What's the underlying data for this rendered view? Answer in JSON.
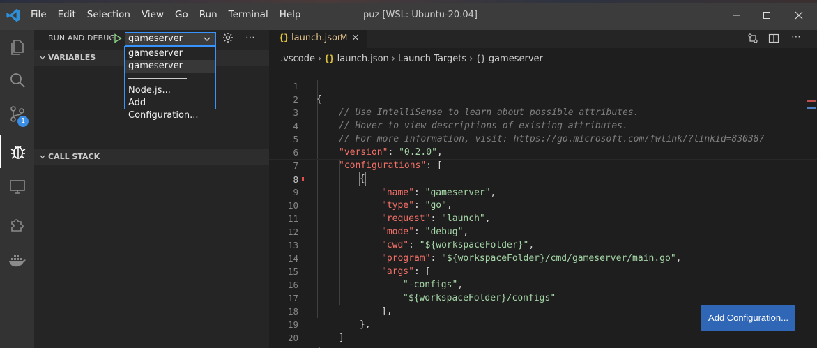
{
  "titlebar": {
    "menu": [
      "File",
      "Edit",
      "Selection",
      "View",
      "Go",
      "Run",
      "Terminal",
      "Help"
    ],
    "window_title": "puz [WSL: Ubuntu-20.04]",
    "controls": [
      "minimize-icon",
      "maximize-icon",
      "close-icon"
    ]
  },
  "activitybar": {
    "items": [
      "explorer-icon",
      "search-icon",
      "source-control-icon",
      "run-debug-icon",
      "remote-explorer-icon",
      "extensions-icon",
      "docker-icon"
    ],
    "source_control_badge": "1"
  },
  "sidebar": {
    "run_title": "RUN AND DEBUG",
    "selected_config": "gameserver",
    "dropdown_options": [
      "gameserver",
      "gameserver",
      "Node.js...",
      "Add Configuration..."
    ],
    "variables_label": "VARIABLES",
    "callstack_label": "CALL STACK"
  },
  "editor": {
    "tab": {
      "icon": "{}",
      "label": "launch.json",
      "modified": "M",
      "close": "×"
    },
    "breadcrumb": [
      ".vscode",
      "launch.json",
      "Launch Targets",
      "gameserver"
    ],
    "lines": [
      {
        "n": "1"
      },
      {
        "n": "2"
      },
      {
        "n": "3"
      },
      {
        "n": "4"
      },
      {
        "n": "5"
      },
      {
        "n": "6"
      },
      {
        "n": "7"
      },
      {
        "n": "8"
      },
      {
        "n": "9"
      },
      {
        "n": "10"
      },
      {
        "n": "11"
      },
      {
        "n": "12"
      },
      {
        "n": "13"
      },
      {
        "n": "14"
      },
      {
        "n": "15"
      },
      {
        "n": "16"
      },
      {
        "n": "17"
      },
      {
        "n": "18"
      },
      {
        "n": "19"
      },
      {
        "n": "20"
      }
    ],
    "code": {
      "l1": "{",
      "l2": "// Use IntelliSense to learn about possible attributes.",
      "l3": "// Hover to view descriptions of existing attributes.",
      "l4": "// For more information, visit: https://go.microsoft.com/fwlink/?linkid=830387",
      "l5_key": "\"version\"",
      "l5_val": "\"0.2.0\"",
      "l6_key": "\"configurations\"",
      "l7": "{",
      "l8_key": "\"name\"",
      "l8_val": "\"gameserver\"",
      "l9_key": "\"type\"",
      "l9_val": "\"go\"",
      "l10_key": "\"request\"",
      "l10_val": "\"launch\"",
      "l11_key": "\"mode\"",
      "l11_val": "\"debug\"",
      "l12_key": "\"cwd\"",
      "l12_val": "\"${workspaceFolder}\"",
      "l13_key": "\"program\"",
      "l13_val": "\"${workspaceFolder}/cmd/gameserver/main.go\"",
      "l14_key": "\"args\"",
      "l15_val": "\"-configs\"",
      "l16_val": "\"${workspaceFolder}/configs\"",
      "l17": "],",
      "l18": "},",
      "l19": "]",
      "l20": "}"
    },
    "add_config_button": "Add Configuration..."
  }
}
